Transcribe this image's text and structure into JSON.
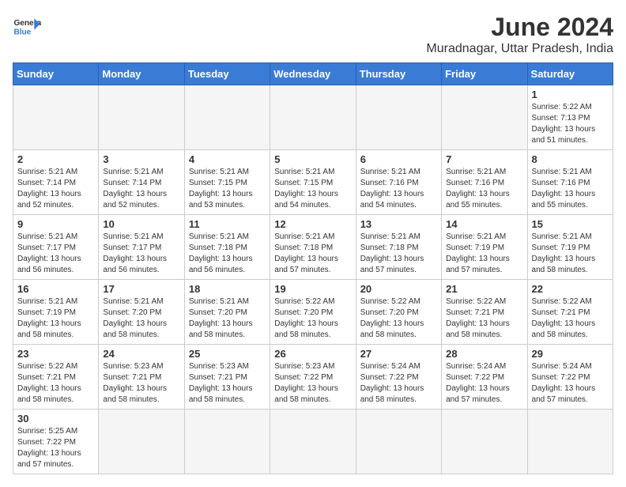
{
  "header": {
    "logo_general": "General",
    "logo_blue": "Blue",
    "month_title": "June 2024",
    "location": "Muradnagar, Uttar Pradesh, India"
  },
  "days_of_week": [
    "Sunday",
    "Monday",
    "Tuesday",
    "Wednesday",
    "Thursday",
    "Friday",
    "Saturday"
  ],
  "weeks": [
    [
      {
        "day": "",
        "info": ""
      },
      {
        "day": "",
        "info": ""
      },
      {
        "day": "",
        "info": ""
      },
      {
        "day": "",
        "info": ""
      },
      {
        "day": "",
        "info": ""
      },
      {
        "day": "",
        "info": ""
      },
      {
        "day": "1",
        "info": "Sunrise: 5:22 AM\nSunset: 7:13 PM\nDaylight: 13 hours\nand 51 minutes."
      }
    ],
    [
      {
        "day": "2",
        "info": "Sunrise: 5:21 AM\nSunset: 7:14 PM\nDaylight: 13 hours\nand 52 minutes."
      },
      {
        "day": "3",
        "info": "Sunrise: 5:21 AM\nSunset: 7:14 PM\nDaylight: 13 hours\nand 52 minutes."
      },
      {
        "day": "4",
        "info": "Sunrise: 5:21 AM\nSunset: 7:15 PM\nDaylight: 13 hours\nand 53 minutes."
      },
      {
        "day": "5",
        "info": "Sunrise: 5:21 AM\nSunset: 7:15 PM\nDaylight: 13 hours\nand 54 minutes."
      },
      {
        "day": "6",
        "info": "Sunrise: 5:21 AM\nSunset: 7:16 PM\nDaylight: 13 hours\nand 54 minutes."
      },
      {
        "day": "7",
        "info": "Sunrise: 5:21 AM\nSunset: 7:16 PM\nDaylight: 13 hours\nand 55 minutes."
      },
      {
        "day": "8",
        "info": "Sunrise: 5:21 AM\nSunset: 7:16 PM\nDaylight: 13 hours\nand 55 minutes."
      }
    ],
    [
      {
        "day": "9",
        "info": "Sunrise: 5:21 AM\nSunset: 7:17 PM\nDaylight: 13 hours\nand 56 minutes."
      },
      {
        "day": "10",
        "info": "Sunrise: 5:21 AM\nSunset: 7:17 PM\nDaylight: 13 hours\nand 56 minutes."
      },
      {
        "day": "11",
        "info": "Sunrise: 5:21 AM\nSunset: 7:18 PM\nDaylight: 13 hours\nand 56 minutes."
      },
      {
        "day": "12",
        "info": "Sunrise: 5:21 AM\nSunset: 7:18 PM\nDaylight: 13 hours\nand 57 minutes."
      },
      {
        "day": "13",
        "info": "Sunrise: 5:21 AM\nSunset: 7:18 PM\nDaylight: 13 hours\nand 57 minutes."
      },
      {
        "day": "14",
        "info": "Sunrise: 5:21 AM\nSunset: 7:19 PM\nDaylight: 13 hours\nand 57 minutes."
      },
      {
        "day": "15",
        "info": "Sunrise: 5:21 AM\nSunset: 7:19 PM\nDaylight: 13 hours\nand 58 minutes."
      }
    ],
    [
      {
        "day": "16",
        "info": "Sunrise: 5:21 AM\nSunset: 7:19 PM\nDaylight: 13 hours\nand 58 minutes."
      },
      {
        "day": "17",
        "info": "Sunrise: 5:21 AM\nSunset: 7:20 PM\nDaylight: 13 hours\nand 58 minutes."
      },
      {
        "day": "18",
        "info": "Sunrise: 5:21 AM\nSunset: 7:20 PM\nDaylight: 13 hours\nand 58 minutes."
      },
      {
        "day": "19",
        "info": "Sunrise: 5:22 AM\nSunset: 7:20 PM\nDaylight: 13 hours\nand 58 minutes."
      },
      {
        "day": "20",
        "info": "Sunrise: 5:22 AM\nSunset: 7:20 PM\nDaylight: 13 hours\nand 58 minutes."
      },
      {
        "day": "21",
        "info": "Sunrise: 5:22 AM\nSunset: 7:21 PM\nDaylight: 13 hours\nand 58 minutes."
      },
      {
        "day": "22",
        "info": "Sunrise: 5:22 AM\nSunset: 7:21 PM\nDaylight: 13 hours\nand 58 minutes."
      }
    ],
    [
      {
        "day": "23",
        "info": "Sunrise: 5:22 AM\nSunset: 7:21 PM\nDaylight: 13 hours\nand 58 minutes."
      },
      {
        "day": "24",
        "info": "Sunrise: 5:23 AM\nSunset: 7:21 PM\nDaylight: 13 hours\nand 58 minutes."
      },
      {
        "day": "25",
        "info": "Sunrise: 5:23 AM\nSunset: 7:21 PM\nDaylight: 13 hours\nand 58 minutes."
      },
      {
        "day": "26",
        "info": "Sunrise: 5:23 AM\nSunset: 7:22 PM\nDaylight: 13 hours\nand 58 minutes."
      },
      {
        "day": "27",
        "info": "Sunrise: 5:24 AM\nSunset: 7:22 PM\nDaylight: 13 hours\nand 58 minutes."
      },
      {
        "day": "28",
        "info": "Sunrise: 5:24 AM\nSunset: 7:22 PM\nDaylight: 13 hours\nand 57 minutes."
      },
      {
        "day": "29",
        "info": "Sunrise: 5:24 AM\nSunset: 7:22 PM\nDaylight: 13 hours\nand 57 minutes."
      }
    ],
    [
      {
        "day": "30",
        "info": "Sunrise: 5:25 AM\nSunset: 7:22 PM\nDaylight: 13 hours\nand 57 minutes."
      },
      {
        "day": "",
        "info": ""
      },
      {
        "day": "",
        "info": ""
      },
      {
        "day": "",
        "info": ""
      },
      {
        "day": "",
        "info": ""
      },
      {
        "day": "",
        "info": ""
      },
      {
        "day": "",
        "info": ""
      }
    ]
  ]
}
